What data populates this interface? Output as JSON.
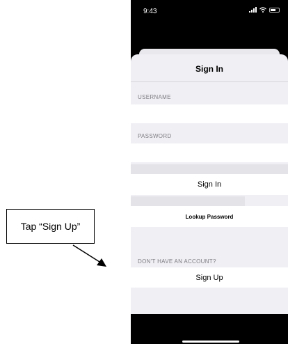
{
  "callout": {
    "text": "Tap “Sign Up”"
  },
  "status": {
    "time": "9:43"
  },
  "sheet": {
    "title": "Sign In",
    "username_label": "USERNAME",
    "username_value": "",
    "password_label": "PASSWORD",
    "password_value": "",
    "sign_in_label": "Sign In",
    "lookup_password_label": "Lookup Password",
    "no_account_label": "DON'T HAVE AN ACCOUNT?",
    "sign_up_label": "Sign Up"
  },
  "icons": [
    "signal-icon",
    "wifi-icon",
    "battery-icon"
  ],
  "colors": {
    "sheet_bg": "#efeff4",
    "cell_bg": "#ffffff",
    "label_gray": "#7d7d82"
  }
}
